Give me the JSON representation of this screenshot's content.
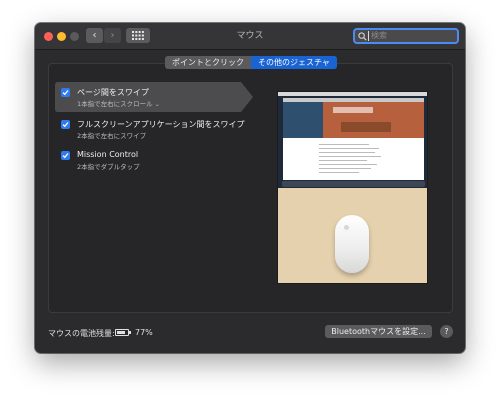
{
  "window": {
    "title": "マウス",
    "nav_back_icon": "chevron-left-icon",
    "nav_forward_icon": "chevron-right-icon",
    "grid_icon": "grid-icon"
  },
  "search": {
    "placeholder": "検索"
  },
  "tabs": [
    {
      "label": "ポイントとクリック",
      "selected": false
    },
    {
      "label": "その他のジェスチャ",
      "selected": true
    }
  ],
  "gestures": [
    {
      "title": "ページ間をスワイプ",
      "subtitle": "1本指で左右にスクロール",
      "has_dropdown": true,
      "checked": true,
      "selected": true
    },
    {
      "title": "フルスクリーンアプリケーション間をスワイプ",
      "subtitle": "2本指で左右にスワイプ",
      "has_dropdown": false,
      "checked": true,
      "selected": false
    },
    {
      "title": "Mission Control",
      "subtitle": "2本指でダブルタップ",
      "has_dropdown": false,
      "checked": true,
      "selected": false
    }
  ],
  "footer": {
    "battery_label": "マウスの電池残量:",
    "battery_percent": "77%",
    "battery_level": 0.77,
    "bluetooth_button": "Bluetoothマウスを設定...",
    "help_button": "?"
  },
  "colors": {
    "accent": "#1a63d2",
    "checkbox": "#2f7bf5",
    "window_bg": "#2b2b2d",
    "close": "#fe5f57",
    "minimize": "#febc2e"
  }
}
